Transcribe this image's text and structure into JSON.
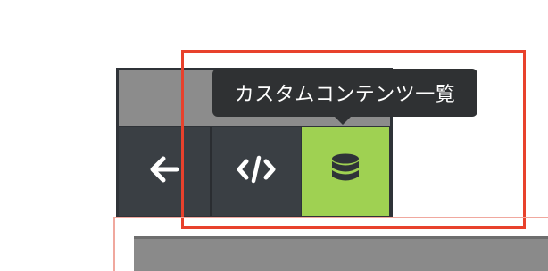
{
  "tooltip": {
    "text": "カスタムコンテンツ一覧"
  },
  "toolbar": {
    "buttons": [
      {
        "name": "back",
        "icon": "arrow-left-icon"
      },
      {
        "name": "code",
        "icon": "code-icon"
      },
      {
        "name": "custom-content-list",
        "icon": "database-icon",
        "active": true
      }
    ]
  },
  "colors": {
    "panel": "#2f3338",
    "active_button": "#9fd152",
    "highlight_border": "#e8412c",
    "tooltip_bg": "#2f3133"
  }
}
